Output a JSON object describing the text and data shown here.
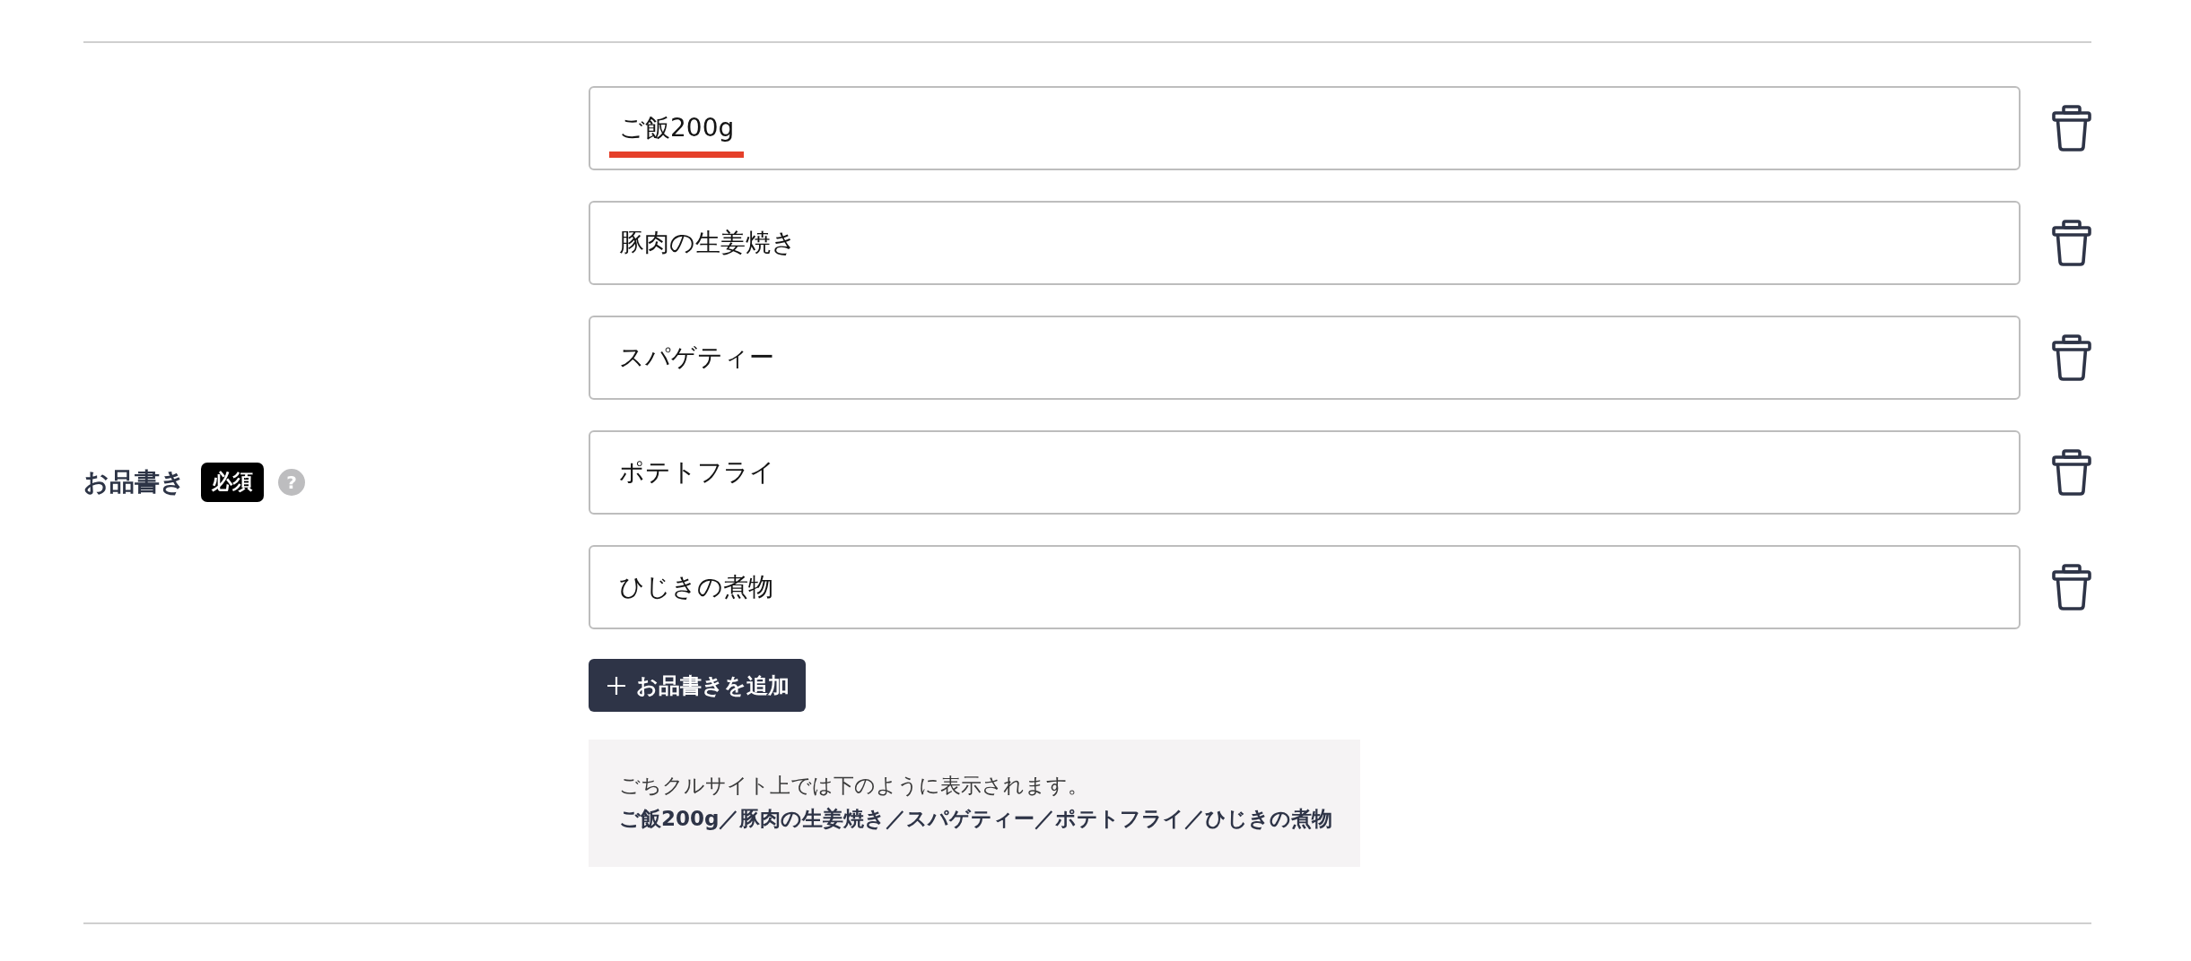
{
  "field": {
    "label": "お品書き",
    "required_badge": "必須",
    "help": "?"
  },
  "items": [
    {
      "value": "ご飯200g",
      "highlighted": true
    },
    {
      "value": "豚肉の生姜焼き",
      "highlighted": false
    },
    {
      "value": "スパゲティー",
      "highlighted": false
    },
    {
      "value": "ポテトフライ",
      "highlighted": false
    },
    {
      "value": "ひじきの煮物",
      "highlighted": false
    }
  ],
  "add_button": {
    "label": "お品書きを追加"
  },
  "preview": {
    "note": "ごちクルサイト上では下のように表示されます。",
    "text": "ご飯200g／豚肉の生姜焼き／スパゲティー／ポテトフライ／ひじきの煮物"
  }
}
